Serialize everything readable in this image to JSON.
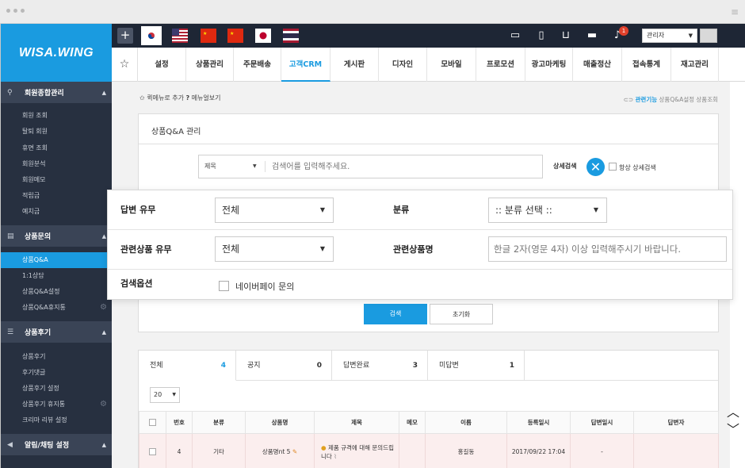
{
  "sidebar": {
    "logo": "WISA.WING",
    "sections": [
      {
        "title": "회원종합관리",
        "icon": "member-icon",
        "items": [
          "회원 조회",
          "탈퇴 회원",
          "휴면 조회",
          "회원분석",
          "회원메모",
          "적립금",
          "예치금"
        ]
      },
      {
        "title": "상품문의",
        "icon": "inquiry-icon",
        "items": [
          "상품Q&A",
          "1:1상담",
          "상품Q&A설정",
          "상품Q&A휴지통"
        ]
      },
      {
        "title": "상품후기",
        "icon": "review-icon",
        "items": [
          "상품후기",
          "후기댓글",
          "상품후기 설정",
          "상품후기 휴지통",
          "크리마 리뷰 설정"
        ]
      },
      {
        "title": "알림/채팅 설정",
        "icon": "megaphone-icon",
        "items": []
      }
    ],
    "active_item": "상품Q&A"
  },
  "topbar": {
    "plus": "+",
    "notification_count": "1",
    "admin": "관리자"
  },
  "menu": {
    "tabs": [
      "설정",
      "상품관리",
      "주문배송",
      "고객CRM",
      "게시판",
      "디자인",
      "모바일",
      "프로모션",
      "광고마케팅",
      "매출정산",
      "접속통계",
      "재고관리"
    ],
    "active": "고객CRM"
  },
  "breadcrumb": {
    "quick_add": "퀵메뉴로 추가",
    "menu_view": "메뉴얼보기",
    "related_label": "관련기능",
    "related_links": [
      "상품Q&A설정",
      "상품조회"
    ]
  },
  "panel": {
    "title": "상품Q&A 관리",
    "search_field": "제목",
    "search_placeholder": "검색어를 입력해주세요.",
    "advanced": "상세검색",
    "always_advanced": "항상 상세검색",
    "search_button": "검색",
    "reset_button": "초기화"
  },
  "filters": {
    "answer_label": "답변 유무",
    "answer_value": "전체",
    "category_label": "분류",
    "category_value": ":: 분류 선택 ::",
    "related_label": "관련상품 유무",
    "related_value": "전체",
    "product_name_label": "관련상품명",
    "product_name_placeholder": "한글 2자(영문 4자) 이상 입력해주시기 바랍니다.",
    "option_label": "검색옵션",
    "naverpay_label": "네이버페이 문의"
  },
  "list": {
    "tabs": [
      {
        "label": "전체",
        "count": "4"
      },
      {
        "label": "공지",
        "count": "0"
      },
      {
        "label": "답변완료",
        "count": "3"
      },
      {
        "label": "미답변",
        "count": "1"
      }
    ],
    "page_size": "20",
    "columns": [
      "번호",
      "분류",
      "상품명",
      "제목",
      "메모",
      "이름",
      "등록일시",
      "답변일시",
      "답변자"
    ],
    "rows": [
      {
        "no": "4",
        "category": "기타",
        "product": "상품명nt 5",
        "title": "제품 규격에 대해 문의드립니다",
        "memo": "",
        "name": "홍길동",
        "date": "2017/09/22 17:04",
        "answer_date": "-",
        "answerer": ""
      }
    ]
  },
  "colors": {
    "accent": "#1a9be0",
    "sidebar_bg": "#273040",
    "topbar_bg": "#1e2635"
  }
}
